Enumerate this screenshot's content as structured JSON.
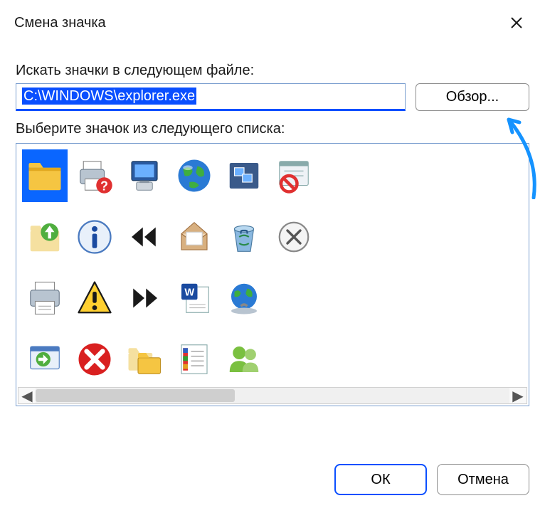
{
  "title": "Смена значка",
  "labels": {
    "search_in_file": "Искать значки в следующем файле:",
    "select_from_list": "Выберите значок из следующего списка:"
  },
  "path_value": "C:\\WINDOWS\\explorer.exe",
  "buttons": {
    "browse": "Обзор...",
    "ok": "ОК",
    "cancel": "Отмена"
  },
  "selected_icon_index": 0,
  "icons": [
    {
      "name": "folder-icon"
    },
    {
      "name": "printer-help-icon"
    },
    {
      "name": "computer-icon"
    },
    {
      "name": "globe-icon"
    },
    {
      "name": "windows-tile-icon"
    },
    {
      "name": "window-blocked-icon"
    },
    {
      "name": "folder-up-icon"
    },
    {
      "name": "info-icon"
    },
    {
      "name": "rewind-icon"
    },
    {
      "name": "envelope-open-icon"
    },
    {
      "name": "recycle-bin-icon"
    },
    {
      "name": "close-circle-icon"
    },
    {
      "name": "printer-icon"
    },
    {
      "name": "warning-icon"
    },
    {
      "name": "forward-icon"
    },
    {
      "name": "word-doc-icon"
    },
    {
      "name": "globe-network-icon"
    },
    {
      "name": "placeholder-empty"
    },
    {
      "name": "window-arrow-icon"
    },
    {
      "name": "error-icon"
    },
    {
      "name": "folder-copy-icon"
    },
    {
      "name": "list-column-icon"
    },
    {
      "name": "people-icon"
    },
    {
      "name": "placeholder-empty"
    }
  ]
}
